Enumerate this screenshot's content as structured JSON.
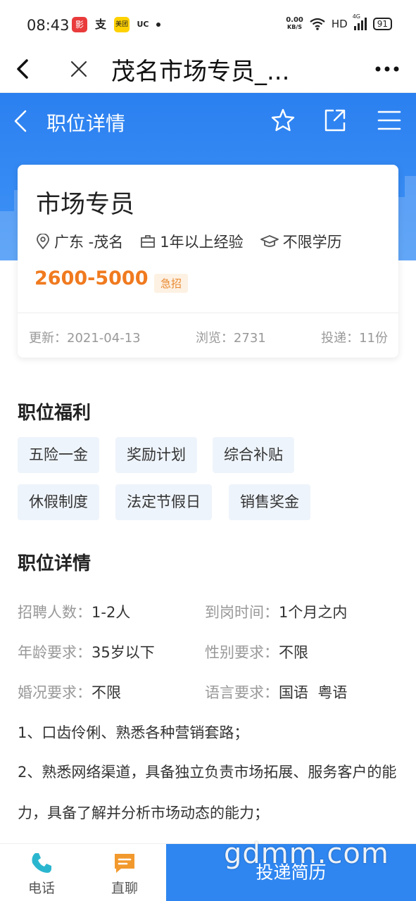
{
  "status_bar": {
    "time": "08:43",
    "apps": [
      {
        "icon": "app-icon-red",
        "color": "#e93b3b",
        "glyph": "影"
      },
      {
        "icon": "alipay-text-icon",
        "color": "#ffffff",
        "glyph": "支"
      },
      {
        "icon": "meituan-icon",
        "color": "#ffd100",
        "glyph": "美团"
      },
      {
        "icon": "uc-browser-icon",
        "color": "#ffffff",
        "glyph": "UC"
      }
    ],
    "speed_value": "0.00",
    "speed_unit": "KB/S",
    "network": "HD",
    "signal": "4G",
    "battery": "91"
  },
  "browser": {
    "title": "茂名市场专员_..."
  },
  "header": {
    "title": "职位详情"
  },
  "job": {
    "title": "市场专员",
    "location": "广东 -茂名",
    "experience": "1年以上经验",
    "education": "不限学历",
    "salary": "2600-5000",
    "badge": "急招",
    "updated": "更新：2021-04-13",
    "views": "浏览：2731",
    "applications": "投递：11份"
  },
  "benefits": {
    "title": "职位福利",
    "tags": [
      "五险一金",
      "奖励计划",
      "综合补贴",
      "休假制度",
      "法定节假日",
      "销售奖金"
    ]
  },
  "details": {
    "title": "职位详情",
    "rows": [
      {
        "label": "招聘人数：",
        "value": "1-2人"
      },
      {
        "label": "到岗时间：",
        "value": "1个月之内"
      },
      {
        "label": "年龄要求：",
        "value": "35岁以下"
      },
      {
        "label": "性别要求：",
        "value": "不限"
      },
      {
        "label": "婚况要求：",
        "value": "不限"
      },
      {
        "label": "语言要求：",
        "value": "国语  粤语"
      }
    ],
    "description": [
      "1、口齿伶俐、熟悉各种营销套路；",
      "2、熟悉网络渠道，具备独立负责市场拓展、服务客户的能力，具备了解并分析市场动态的能力；"
    ]
  },
  "bottom": {
    "phone_label": "电话",
    "chat_label": "直聊",
    "apply_label": "投递简历"
  },
  "watermark": "gdmm.com",
  "colors": {
    "primary_blue": "#2f86f0",
    "salary_orange": "#f07a1f",
    "tag_bg": "#eef4fb",
    "icon_teal": "#2bb6cf",
    "icon_orange": "#f2992e"
  }
}
